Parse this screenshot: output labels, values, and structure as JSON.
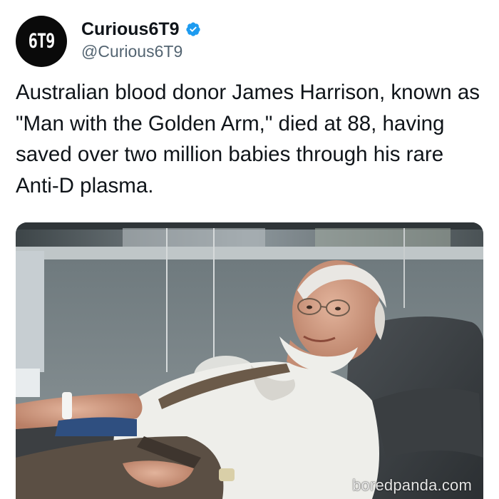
{
  "author": {
    "avatar_text": "6T9",
    "display_name": "Curious6T9",
    "handle": "@Curious6T9",
    "verified": true
  },
  "tweet": {
    "text": "Australian blood donor James Harrison, known as \"Man with the Golden Arm,\" died at 88, having saved over two million babies through his rare Anti-D plasma."
  },
  "media": {
    "description_icon": "photo",
    "watermark": "boredpanda.com"
  },
  "colors": {
    "verified_badge": "#1d9bf0",
    "handle_text": "#536471",
    "primary_text": "#0f1419"
  }
}
